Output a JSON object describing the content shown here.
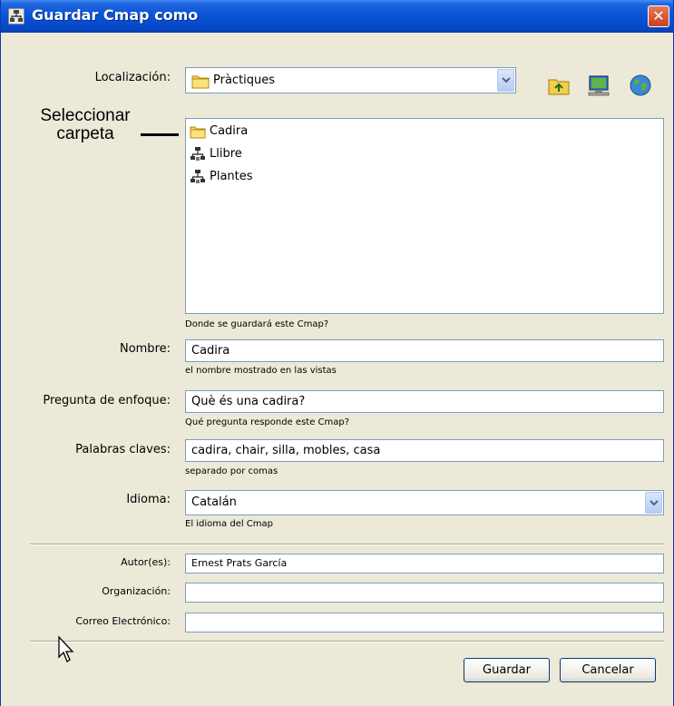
{
  "window": {
    "title": "Guardar Cmap como",
    "close_glyph": "✕"
  },
  "location": {
    "label": "Localización:",
    "value": "Pràctiques",
    "icon": "folder-icon"
  },
  "toolbar": {
    "icons": [
      "up-folder-icon",
      "desktop-icon",
      "globe-icon"
    ]
  },
  "annotation": {
    "text_line1": "Seleccionar",
    "text_line2": "carpeta"
  },
  "files": [
    {
      "name": "Cadira",
      "icon": "folder-icon"
    },
    {
      "name": "Llibre",
      "icon": "cmap-icon"
    },
    {
      "name": "Plantes",
      "icon": "cmap-icon"
    }
  ],
  "files_hint": "Donde se guardará este Cmap?",
  "name_field": {
    "label": "Nombre:",
    "value": "Cadira",
    "hint": "el nombre mostrado en las vistas"
  },
  "focus_question": {
    "label": "Pregunta de enfoque:",
    "value": "Què és una cadira?",
    "hint": "Qué pregunta responde este Cmap?"
  },
  "keywords": {
    "label": "Palabras claves:",
    "value": "cadira, chair, silla, mobles, casa",
    "hint": "separado por comas"
  },
  "language": {
    "label": "Idioma:",
    "value": "Catalán",
    "hint": "El idioma del Cmap"
  },
  "authors": {
    "label": "Autor(es):",
    "value": "Ernest Prats García"
  },
  "organization": {
    "label": "Organización:",
    "value": ""
  },
  "email": {
    "label": "Correo Electrónico:",
    "value": ""
  },
  "buttons": {
    "save": "Guardar",
    "cancel": "Cancelar"
  },
  "colors": {
    "titlebar": "#0548c8",
    "dialog_bg": "#ece9d8",
    "field_border": "#7f9db9"
  }
}
